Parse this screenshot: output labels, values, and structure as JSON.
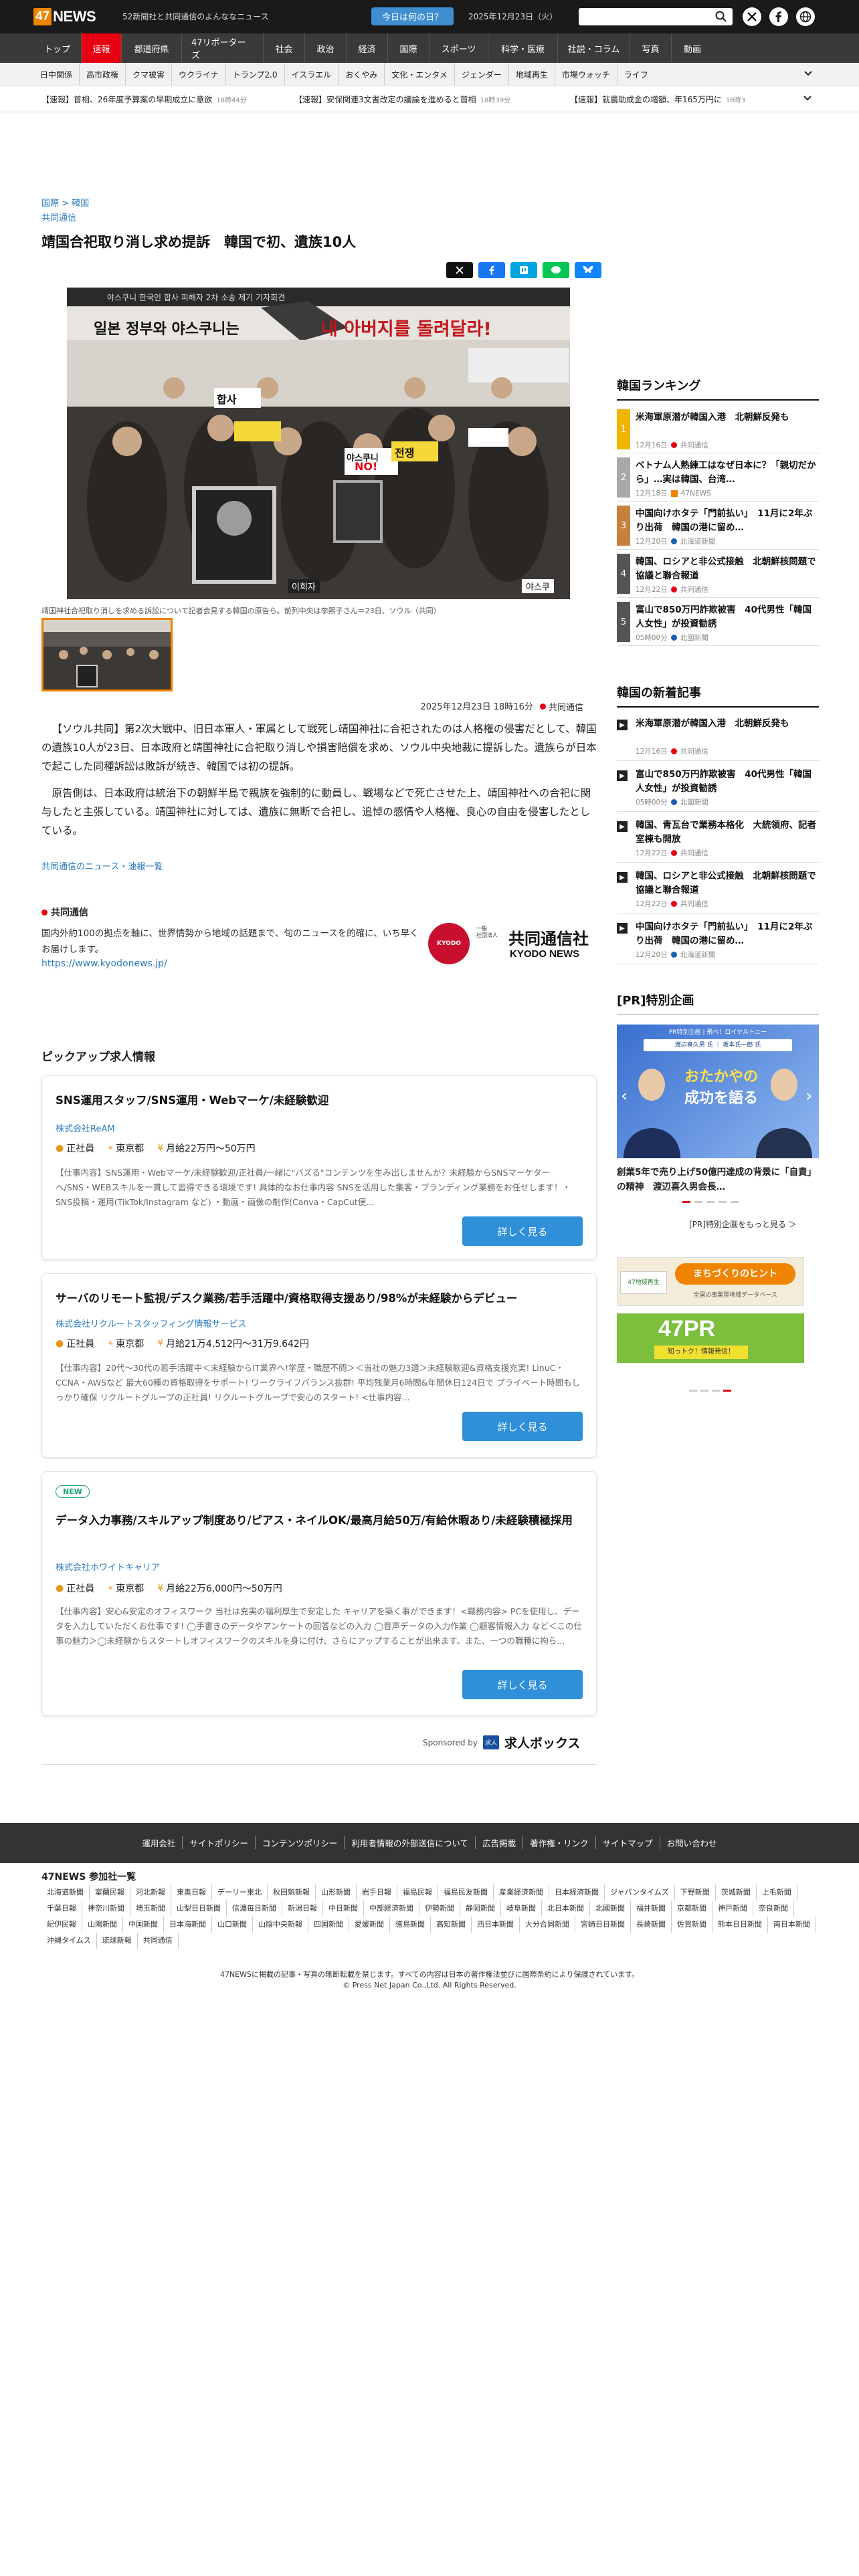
{
  "header": {
    "logo_num": "47",
    "logo_text": "NEWS",
    "tagline": "52新聞社と共同通信のよんななニュース",
    "today_button": "今日は何の日？",
    "date": "2025年12月23日（火）",
    "search_placeholder": ""
  },
  "nav": {
    "items": [
      "トップ",
      "速報",
      "都道府県",
      "47リポーターズ",
      "社会",
      "政治",
      "経済",
      "国際",
      "スポーツ",
      "科学・医療",
      "社説・コラム",
      "写真",
      "動画"
    ],
    "active": "速報"
  },
  "subnav": {
    "items": [
      "日中関係",
      "高市政権",
      "クマ被害",
      "ウクライナ",
      "トランプ2.0",
      "イスラエル",
      "おくやみ",
      "文化・エンタメ",
      "ジェンダー",
      "地域再生",
      "市場ウォッチ",
      "ライフ"
    ]
  },
  "ticker": [
    {
      "text": "【速報】首相、26年度予算案の早期成立に意欲",
      "time": "18時44分"
    },
    {
      "text": "【速報】安保関連3文書改定の議論を進めると首相",
      "time": "18時39分"
    },
    {
      "text": "【速報】就農助成金の増額、年165万円に",
      "time": "18時3"
    }
  ],
  "article": {
    "breadcrumb_a": "国際",
    "breadcrumb_sep": ">",
    "breadcrumb_b": "韓国",
    "source_link": "共同通信",
    "title": "靖国合祀取り消し求め提訴　韓国で初、遺族10人",
    "image_banner_top": "야스쿠니 한국인 합사 피해자 2차 소송 제기 기자회견",
    "image_banner_main_a": "일본 정부와 야스쿠니는",
    "image_banner_main_b": "내 아버지를 돌려달라!",
    "image_sign_a": "합사",
    "image_sign_b": "야스쿠니",
    "image_sign_c": "NO!",
    "image_sign_d": "전쟁",
    "image_name_a": "이희자",
    "image_name_b": "야스쿠",
    "caption": "靖国神社合祀取り消しを求める訴訟について記者会見する韓国の原告ら。前列中央は李熙子さん＝23日、ソウル（共同）",
    "date_meta": "2025年12月23日 18時16分",
    "publisher": "共同通信",
    "para1": "【ソウル共同】第2次大戦中、旧日本軍人・軍属として戦死し靖国神社に合祀されたのは人格権の侵害だとして、韓国の遺族10人が23日、日本政府と靖国神社に合祀取り消しや損害賠償を求め、ソウル中央地裁に提訴した。遺族らが日本で起こした同種訴訟は敗訴が続き、韓国では初の提訴。",
    "para2": "原告側は、日本政府は統治下の朝鮮半島で親族を強制的に動員し、戦場などで死亡させた上、靖国神社への合祀に関与したと主張している。靖国神社に対しては、遺族に無断で合祀し、追悼の感情や人格権、良心の自由を侵害したとしている。",
    "more_link": "共同通信のニュース・速報一覧"
  },
  "publisher_box": {
    "name": "共同通信",
    "desc": "国内外約100の拠点を軸に、世界情勢から地域の話題まで、旬のニュースを的確に、いち早くお届けします。",
    "url": "https://www.kyodonews.jp/",
    "logo_small_a": "一般",
    "logo_small_b": "社団法人",
    "logo_big": "共同通信社",
    "logo_en": "KYODO NEWS",
    "logo_badge": "KYODO"
  },
  "jobs": {
    "heading": "ピックアップ求人情報",
    "items": [
      {
        "title": "SNS運用スタッフ/SNS運用・Webマーケ/未経験歓迎",
        "company": "株式会社ReAM",
        "type": "正社員",
        "place": "東京都",
        "salary": "月給22万円〜50万円",
        "desc": "【仕事内容】SNS運用・Webマーケ/未経験歓迎/正社員/一緒に\"バズる\"コンテンツを生み出しませんか？未経験からSNSマーケターへ/SNS・WEBスキルを一貫して習得できる環境です! 具体的なお仕事内容 SNSを活用した集客・ブランディング業務をお任せします！・SNS投稿・運用(TikTok/Instagram など) ・動画・画像の制作(Canva・CapCut便...",
        "button": "詳しく見る",
        "new": ""
      },
      {
        "title": "サーバのリモート監視/デスク業務/若手活躍中/資格取得支援あり/98%が未経験からデビュー",
        "company": "株式会社リクルートスタッフィング情報サービス",
        "type": "正社員",
        "place": "東京都",
        "salary": "月給21万4,512円〜31万9,642円",
        "desc": "【仕事内容】20代〜30代の若手活躍中＜未経験からIT業界へ!学歴・職歴不問＞＜当社の魅力3選＞未経験歓迎&資格支援充実! LinuC・CCNA・AWSなど 最大60種の資格取得をサポート! ワークライフバランス抜群! 平均残業月6時間&年間休日124日で プライベート時間もしっかり確保 リクルートグループの正社員! リクルートグループで安心のスタート! <仕事内容...",
        "button": "詳しく見る",
        "new": ""
      },
      {
        "title": "データ入力事務/スキルアップ制度あり/ピアス・ネイルOK/最高月給50万/有給休暇あり/未経験積極採用",
        "company": "株式会社ホワイトキャリア",
        "type": "正社員",
        "place": "東京都",
        "salary": "月給22万6,000円〜50万円",
        "desc": "【仕事内容】安心&安定のオフィスワーク 当社は充実の福利厚生で安定した キャリアを築く事ができます！<職務内容> PCを使用し、データを入力していただくお仕事です! ◯手書きのデータやアンケートの回答などの入力 ◯音声データの入力作業 ◯顧客情報入力 など＜この仕事の魅力＞◯未経験からスタートしオフィスワークのスキルを身に付け、さらにアップすることが出来ます。また、一つの職種に拘ら...",
        "button": "詳しく見る",
        "new": "NEW"
      }
    ],
    "sponsored": "Sponsored by",
    "sponsor_badge": "求人",
    "sponsor_name": "求人ボックス"
  },
  "sidebar": {
    "ranking_heading": "韓国ランキング",
    "ranking": [
      {
        "n": "1",
        "title": "米海軍原潜が韓国入港　北朝鮮反発も",
        "time": "12月16日",
        "pub": "共同通信"
      },
      {
        "n": "2",
        "title": "ベトナム人熟練工はなぜ日本に？「親切だから」…実は韓国、台湾…",
        "time": "12月18日",
        "pub": "47NEWS"
      },
      {
        "n": "3",
        "title": "中国向けホタテ「門前払い」　11月に2年ぶり出荷　韓国の港に留め…",
        "time": "12月20日",
        "pub": "北海道新聞"
      },
      {
        "n": "4",
        "title": "韓国、ロシアと非公式接触　北朝鮮核問題で協議と聯合報道",
        "time": "12月22日",
        "pub": "共同通信"
      },
      {
        "n": "5",
        "title": "富山で850万円詐欺被害　40代男性「韓国人女性」が投資勧誘",
        "time": "05時00分",
        "pub": "北國新聞"
      }
    ],
    "new_heading": "韓国の新着記事",
    "new": [
      {
        "title": "米海軍原潜が韓国入港　北朝鮮反発も",
        "time": "12月16日",
        "pub": "共同通信"
      },
      {
        "title": "富山で850万円詐欺被害　40代男性「韓国人女性」が投資勧誘",
        "time": "05時00分",
        "pub": "北國新聞"
      },
      {
        "title": "韓国、青瓦台で業務本格化　大統領府、記者室棟も開放",
        "time": "12月22日",
        "pub": "共同通信"
      },
      {
        "title": "韓国、ロシアと非公式接触　北朝鮮核問題で協議と聯合報道",
        "time": "12月22日",
        "pub": "共同通信"
      },
      {
        "title": "中国向けホタテ「門前払い」　11月に2年ぶり出荷　韓国の港に留め…",
        "time": "12月20日",
        "pub": "北海道新聞"
      }
    ],
    "pr_heading": "[PR]特別企画",
    "pr_banner_top": "PR特別企画 | 飛べ！ロイヤルトニー",
    "pr_banner_pill": "渡辺喜久男 氏 ｜ 坂本氏一郎 氏",
    "pr_banner_big_a": "おたかやの",
    "pr_banner_big_b": "成功を語る",
    "pr_title": "創業5年で売り上げ50億円達成の背景に「自責」の精神　渡辺喜久男会長…",
    "pr_more": "[PR]特別企画をもっと見る ＞",
    "banner1": "まちづくりのヒント",
    "banner1_sub": "全国の事業型地域データベース",
    "banner1_left": "47地域再生",
    "banner2": "47PR",
    "banner2_sub": "知っトク！情報発信！"
  },
  "footer": {
    "links": [
      "運用会社",
      "サイトポリシー",
      "コンテンツポリシー",
      "利用者情報の外部送信について",
      "広告掲載",
      "著作権・リンク",
      "サイトマップ",
      "お問い合わせ"
    ],
    "partners_heading": "47NEWS 参加社一覧",
    "partners": [
      "北海道新聞",
      "室蘭民報",
      "河北新報",
      "東奥日報",
      "デーリー東北",
      "秋田魁新報",
      "山形新聞",
      "岩手日報",
      "福島民報",
      "福島民友新聞",
      "産業経済新聞",
      "日本経済新聞",
      "ジャパンタイムズ",
      "下野新聞",
      "茨城新聞",
      "上毛新聞",
      "千葉日報",
      "神奈川新聞",
      "埼玉新聞",
      "山梨日日新聞",
      "信濃毎日新聞",
      "新潟日報",
      "中日新聞",
      "中部経済新聞",
      "伊勢新聞",
      "静岡新聞",
      "岐阜新聞",
      "北日本新聞",
      "北國新聞",
      "福井新聞",
      "京都新聞",
      "神戸新聞",
      "奈良新聞",
      "紀伊民報",
      "山陽新聞",
      "中国新聞",
      "日本海新聞",
      "山口新聞",
      "山陰中央新報",
      "四国新聞",
      "愛媛新聞",
      "徳島新聞",
      "高知新聞",
      "西日本新聞",
      "大分合同新聞",
      "宮崎日日新聞",
      "長崎新聞",
      "佐賀新聞",
      "熊本日日新聞",
      "南日本新聞",
      "沖縄タイムス",
      "琉球新報",
      "共同通信"
    ],
    "copy1": "47NEWSに掲載の記事・写真の無断転載を禁じます。すべての内容は日本の著作権法並びに国際条約により保護されています。",
    "copy2": "© Press Net Japan Co.,Ltd. All Rights Reserved."
  },
  "colors": {
    "accent": "#e60012",
    "link": "#2b7bbf",
    "brand": "#f08300",
    "button": "#2f8fd8"
  }
}
